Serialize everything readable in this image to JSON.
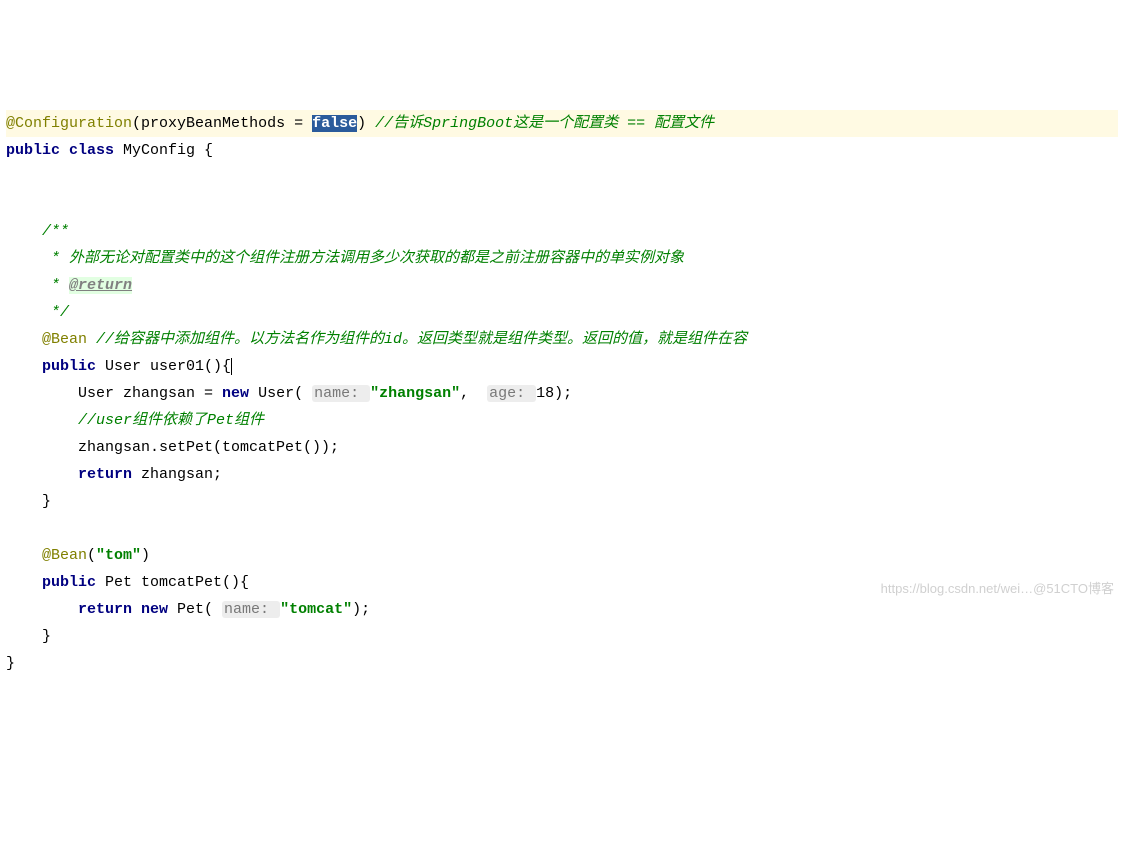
{
  "code": {
    "line1": {
      "annotation": "@Configuration",
      "paren_open": "(",
      "param": "proxyBeanMethods = ",
      "selected": "false",
      "paren_close": ")",
      "comment": " //告诉SpringBoot这是一个配置类 == 配置文件"
    },
    "line2": {
      "keywords": "public class ",
      "classname": "MyConfig {"
    },
    "doc": {
      "l1": "    /**",
      "l2": "     * 外部无论对配置类中的这个组件注册方法调用多少次获取的都是之前注册容器中的单实例对象",
      "l3_prefix": "     * ",
      "l3_tag": "@return",
      "l4": "     */"
    },
    "bean1": {
      "annotation": "    @Bean",
      "comment": " //给容器中添加组件。以方法名作为组件的id。返回类型就是组件类型。返回的值，就是组件在容",
      "sig_pub": "    public ",
      "sig_ret": "User user01(){",
      "body1_pre": "        User zhangsan = ",
      "body1_new": "new ",
      "body1_call": "User( ",
      "body1_hint1": "name: ",
      "body1_str": "\"zhangsan\"",
      "body1_mid": ",  ",
      "body1_hint2": "age: ",
      "body1_num": "18);",
      "body2": "        //user组件依赖了Pet组件",
      "body3": "        zhangsan.setPet(tomcatPet());",
      "body4_ret": "        return ",
      "body4_var": "zhangsan;",
      "close": "    }"
    },
    "bean2": {
      "annotation": "    @Bean",
      "paren_open": "(",
      "str": "\"tom\"",
      "paren_close": ")",
      "sig_pub": "    public ",
      "sig_ret": "Pet tomcatPet(){",
      "body_ret": "        return new ",
      "body_call": "Pet( ",
      "body_hint": "name: ",
      "body_str": "\"tomcat\"",
      "body_end": ");",
      "close": "    }"
    },
    "class_close": "}"
  },
  "watermark": "https://blog.csdn.net/wei…@51CTO博客"
}
